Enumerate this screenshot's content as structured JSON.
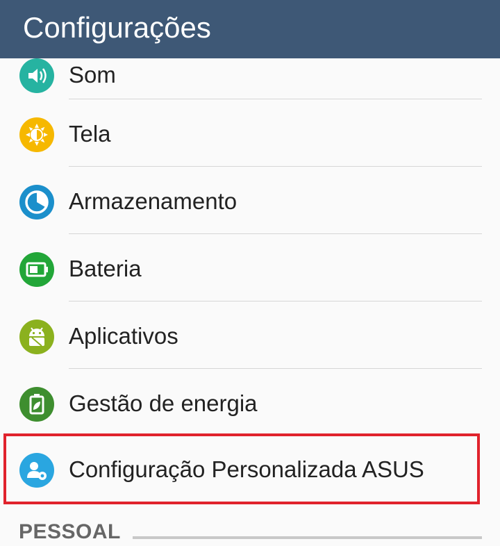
{
  "app_bar": {
    "title": "Configurações"
  },
  "items": [
    {
      "label": "Som",
      "icon": "volume-icon",
      "color": "#26b3a1"
    },
    {
      "label": "Tela",
      "icon": "brightness-icon",
      "color": "#f6b800"
    },
    {
      "label": "Armazenamento",
      "icon": "storage-pie-icon",
      "color": "#1b8fcb"
    },
    {
      "label": "Bateria",
      "icon": "battery-icon",
      "color": "#22a638"
    },
    {
      "label": "Aplicativos",
      "icon": "android-icon",
      "color": "#8bb11e"
    },
    {
      "label": "Gestão de energia",
      "icon": "power-management-leaf-icon",
      "color": "#3e8e2f"
    },
    {
      "label": "Configuração Personalizada ASUS",
      "icon": "user-settings-icon",
      "color": "#2aa6e0"
    }
  ],
  "section": {
    "title": "PESSOAL"
  },
  "highlight_color": "#e0232c"
}
